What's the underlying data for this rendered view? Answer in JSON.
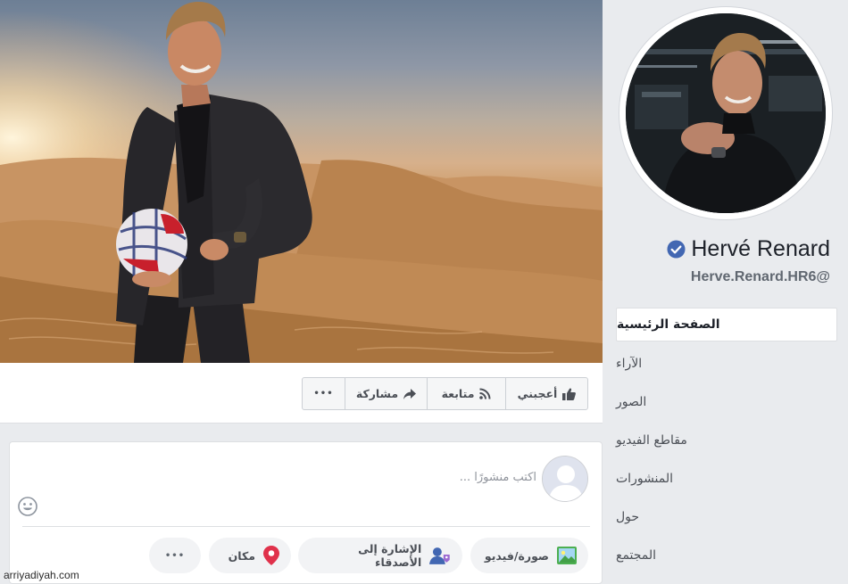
{
  "profile": {
    "name": "Hervé Renard",
    "handle": "Herve.Renard.HR6@"
  },
  "cover_actions": {
    "like": "أعجبني",
    "follow": "متابعة",
    "share": "مشاركة",
    "more": "•••"
  },
  "composer": {
    "placeholder": "اكتب منشورًا ...",
    "photo_video": "صورة/فيديو",
    "tag_friends": "الإشارة إلى الأصدقاء",
    "place": "مكان",
    "more": "•••"
  },
  "nav": {
    "items": [
      {
        "label": "الصفحة الرئيسية"
      },
      {
        "label": "الآراء"
      },
      {
        "label": "الصور"
      },
      {
        "label": "مقاطع الفيديو"
      },
      {
        "label": "المنشورات"
      },
      {
        "label": "حول"
      },
      {
        "label": "المجتمع"
      }
    ]
  },
  "watermark": "arriyadiyah.com",
  "colors": {
    "brand_blue": "#4267b2",
    "page_background": "#e9ebee",
    "place_pin": "#e0314b"
  },
  "icons": {
    "like": "thumbs-up-icon",
    "follow": "rss-icon",
    "share": "share-arrow-icon",
    "verified": "verified-badge-icon",
    "emoji": "smiley-icon",
    "photo": "photo-icon",
    "tag": "tag-friends-icon",
    "place": "map-pin-icon"
  }
}
